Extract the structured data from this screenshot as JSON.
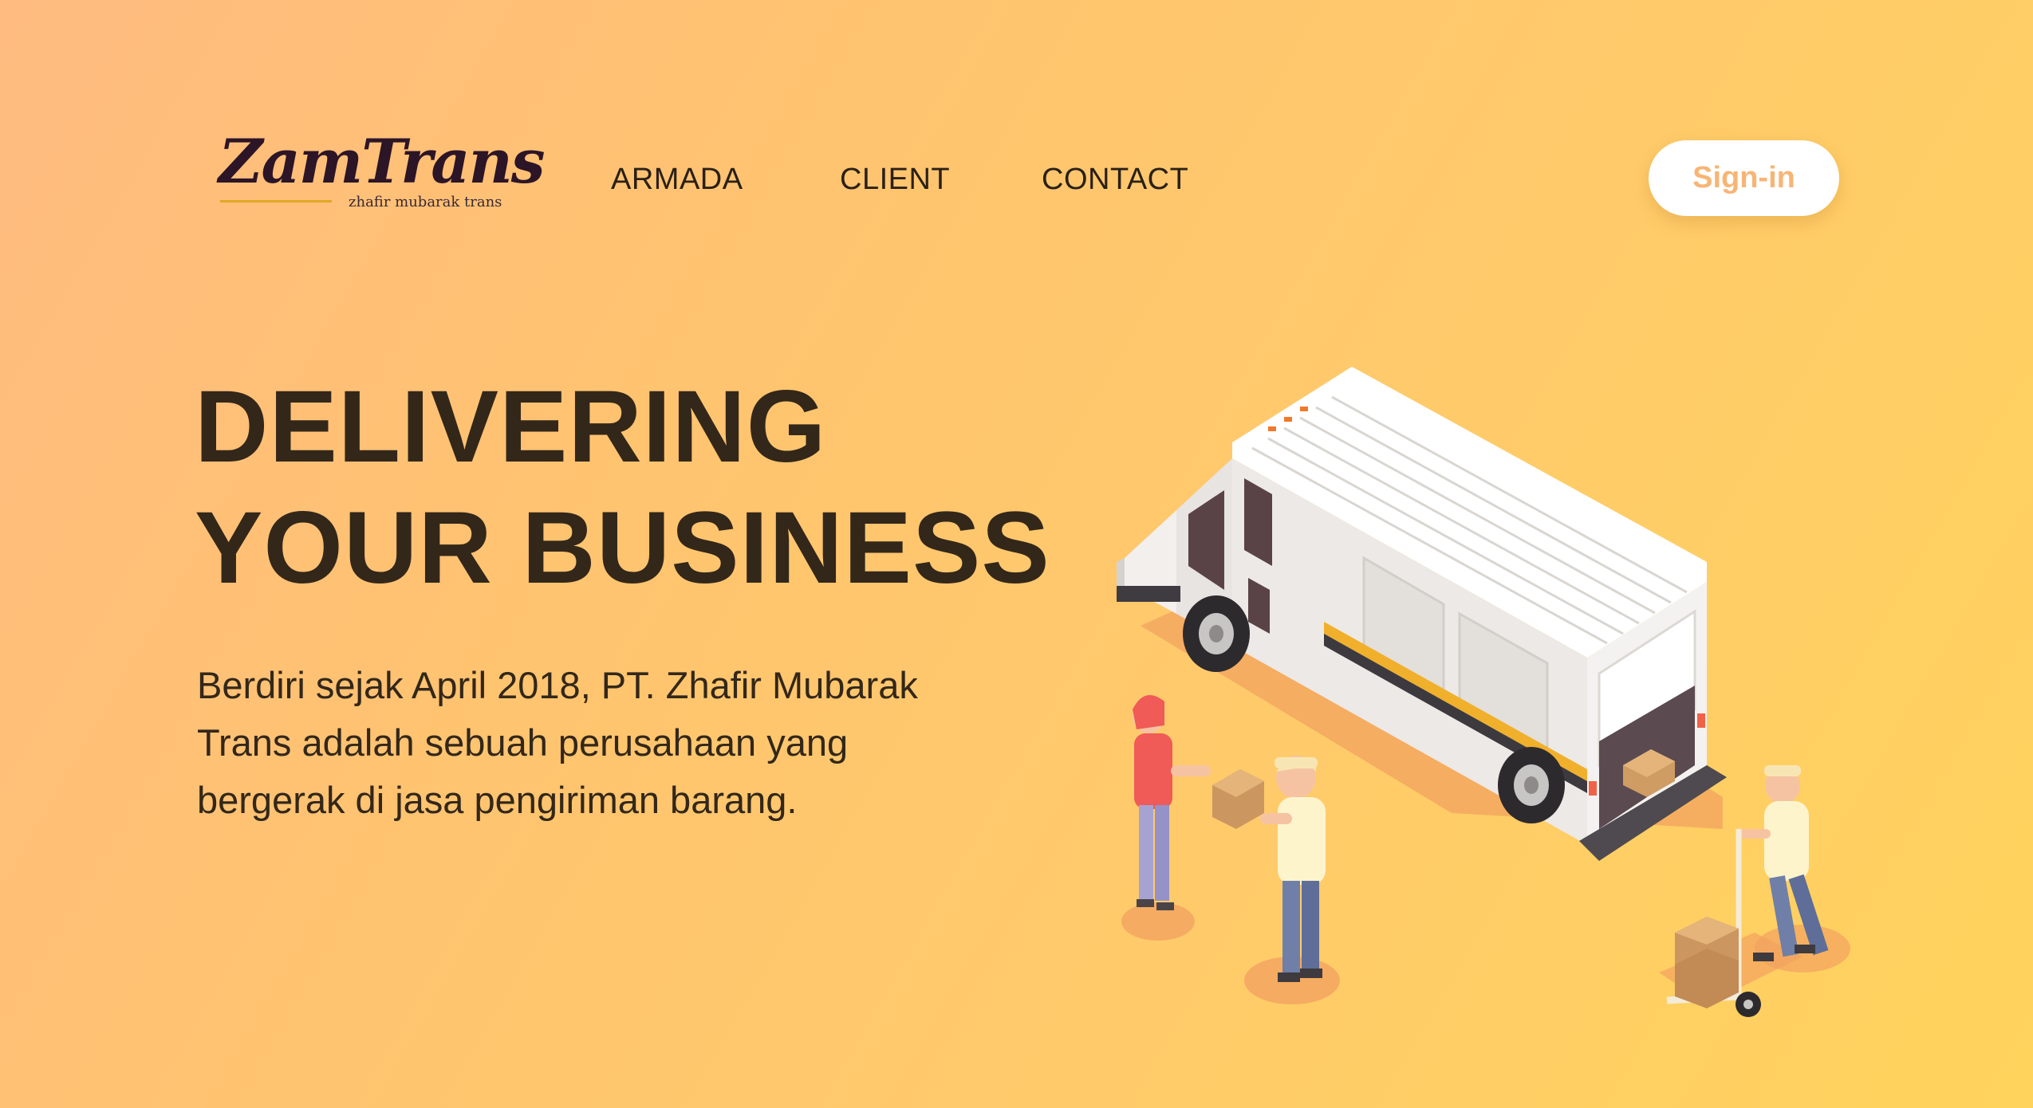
{
  "logo": {
    "name": "ZamTrans",
    "tagline": "zhafir mubarak trans"
  },
  "nav": {
    "items": [
      "ARMADA",
      "CLIENT",
      "CONTACT"
    ]
  },
  "header": {
    "signin_label": "Sign-in"
  },
  "hero": {
    "title_line1": "DELIVERING",
    "title_line2": "YOUR BUSINESS",
    "description": "Berdiri sejak April 2018, PT. Zhafir Mubarak Trans adalah sebuah perusahaan yang bergerak di jasa pengiriman barang."
  },
  "colors": {
    "background_start": "#ffbb80",
    "background_end": "#ffd35c",
    "text_dark": "#33271a",
    "signin_text": "#f7b575",
    "logo": "#2c1526"
  },
  "illustration": {
    "icon": "delivery-van-illustration"
  }
}
